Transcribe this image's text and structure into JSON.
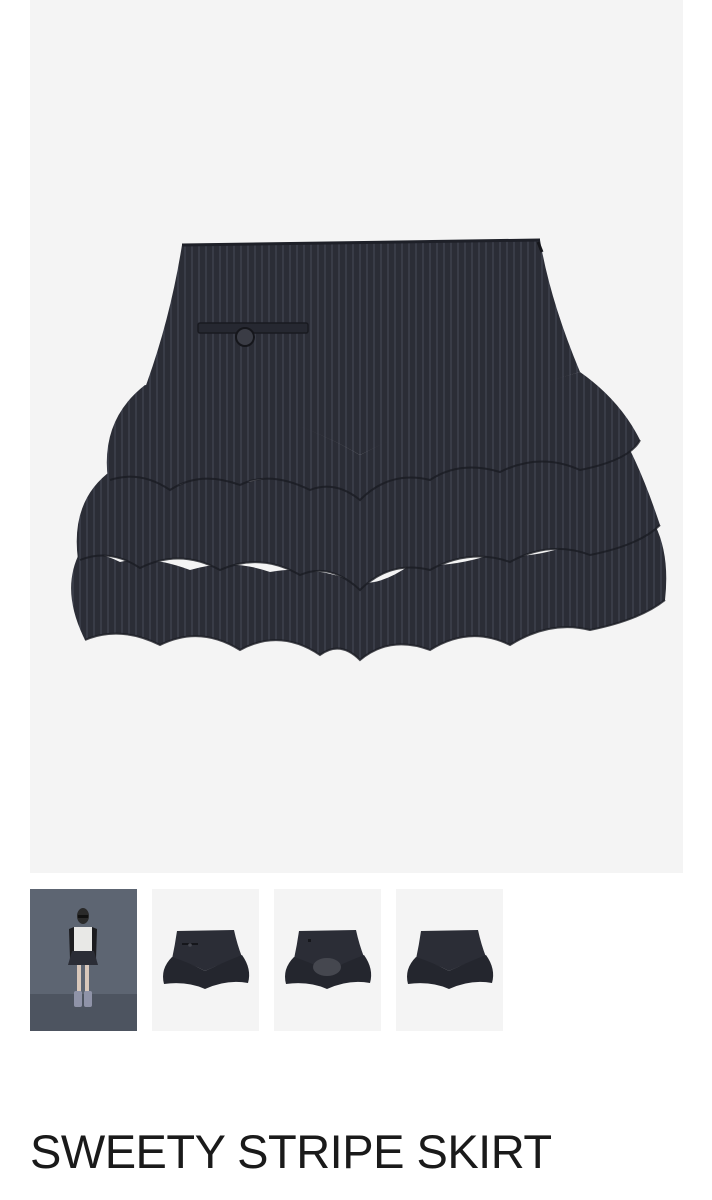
{
  "product": {
    "title": "SWEETY STRIPE SKIRT",
    "main_image": {
      "icon": "skirt-front-image"
    },
    "thumbnails": [
      {
        "icon": "model-photo-thumbnail",
        "selected": false
      },
      {
        "icon": "skirt-front-thumbnail",
        "selected": true
      },
      {
        "icon": "skirt-inside-thumbnail",
        "selected": false
      },
      {
        "icon": "skirt-back-thumbnail",
        "selected": false
      }
    ]
  },
  "colors": {
    "image_background": "#f4f4f4",
    "fabric": "#2b2d36",
    "stripe": "#5b5e6c",
    "model_background": "#5d6572"
  }
}
